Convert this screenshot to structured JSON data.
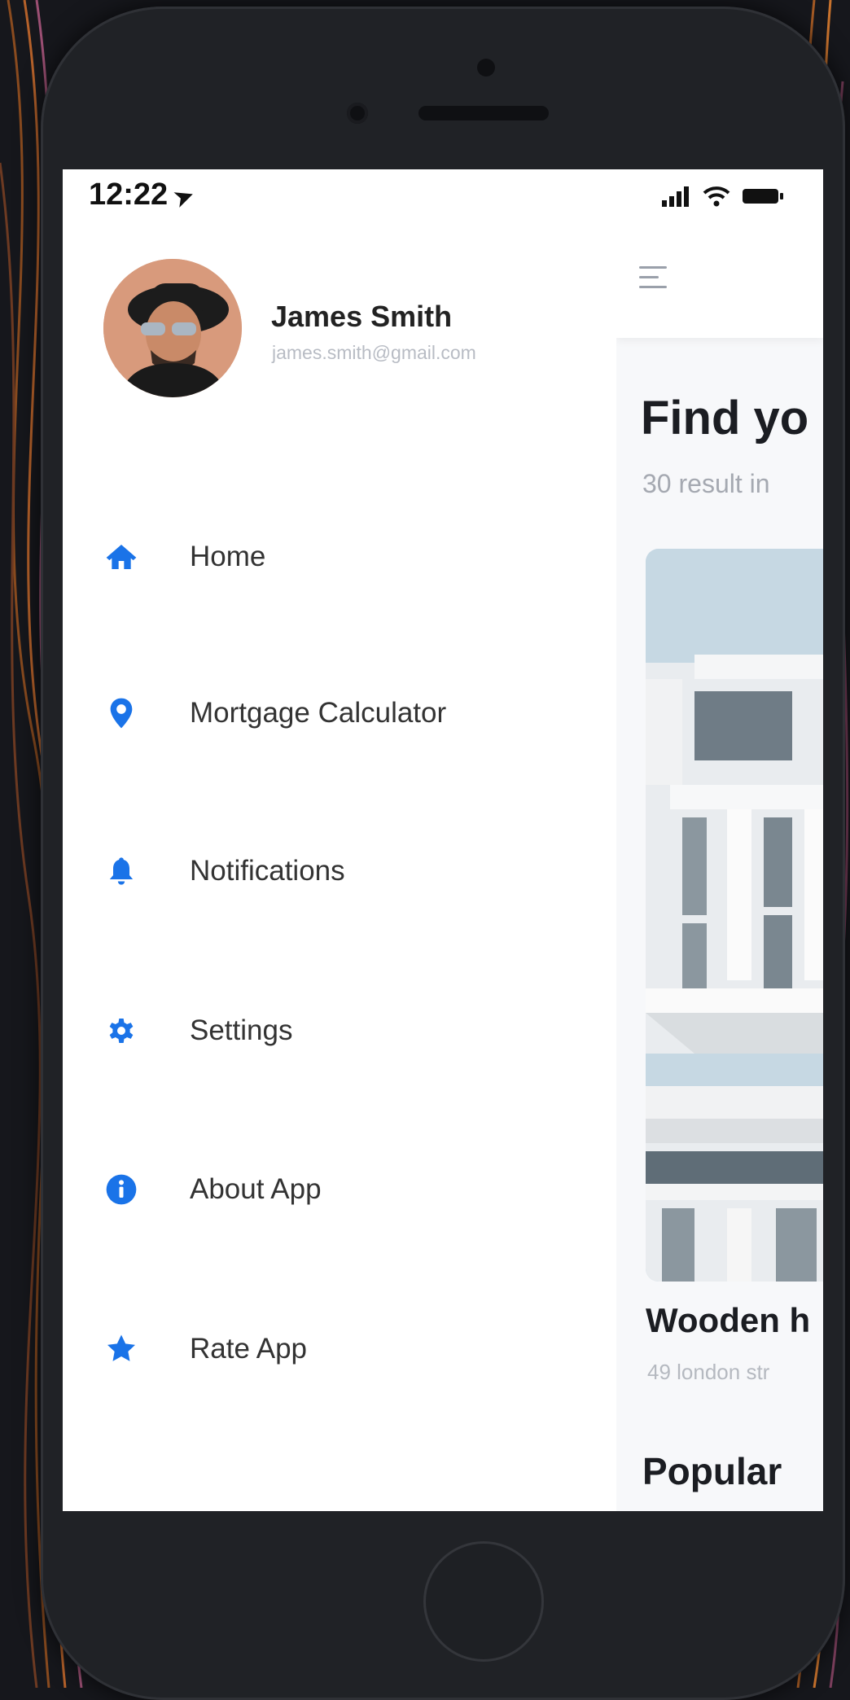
{
  "status_bar": {
    "time": "12:22"
  },
  "user": {
    "name": "James Smith",
    "email": "james.smith@gmail.com"
  },
  "menu": {
    "items": [
      {
        "label": "Home",
        "icon": "home-icon"
      },
      {
        "label": "Mortgage Calculator",
        "icon": "location-pin-icon"
      },
      {
        "label": "Notifications",
        "icon": "bell-icon"
      },
      {
        "label": "Settings",
        "icon": "gear-icon"
      },
      {
        "label": "About App",
        "icon": "info-icon"
      },
      {
        "label": "Rate App",
        "icon": "star-icon"
      }
    ]
  },
  "main": {
    "title": "Find yo",
    "subtitle": "30 result in",
    "featured": {
      "title": "Wooden h",
      "address": "49 london str"
    },
    "section_title": "Popular"
  },
  "colors": {
    "accent": "#1a73e8",
    "text": "#222222",
    "muted": "#b8bcc4"
  }
}
